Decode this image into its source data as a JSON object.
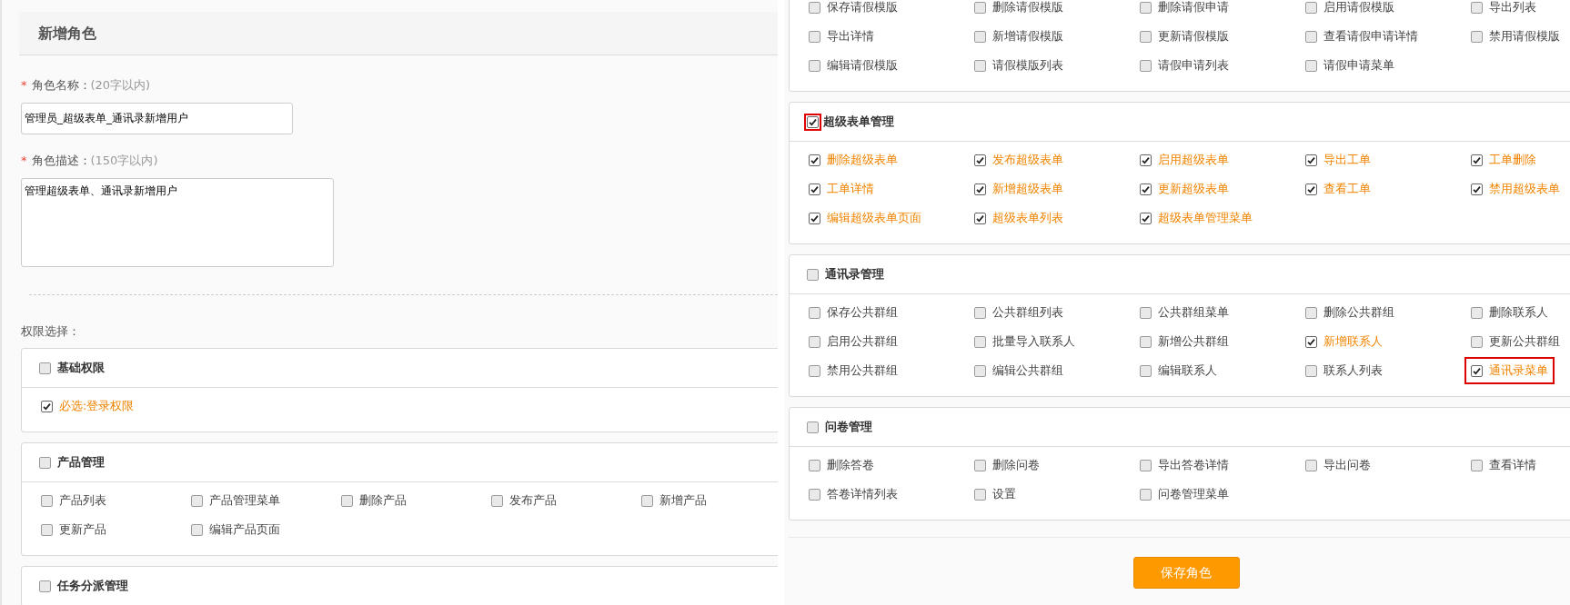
{
  "left": {
    "title": "新增角色",
    "fields": [
      {
        "kind": "input",
        "required_mark": "*",
        "label": "角色名称：",
        "hint": "(20字以内)",
        "value": "管理员_超级表单_通讯录新增用户"
      },
      {
        "kind": "textarea",
        "required_mark": "*",
        "label": "角色描述：",
        "hint": "(150字以内)",
        "value": "管理超级表单、通讯录新增用户"
      }
    ],
    "permissions_label": "权限选择：",
    "groups": [
      {
        "title": "基础权限",
        "checked": false,
        "highlighted": false,
        "items": [
          {
            "label": "必选:登录权限",
            "checked": true,
            "highlighted": false
          }
        ]
      },
      {
        "title": "产品管理",
        "checked": false,
        "highlighted": false,
        "items": [
          {
            "label": "产品列表",
            "checked": false,
            "highlighted": false
          },
          {
            "label": "产品管理菜单",
            "checked": false,
            "highlighted": false
          },
          {
            "label": "删除产品",
            "checked": false,
            "highlighted": false
          },
          {
            "label": "发布产品",
            "checked": false,
            "highlighted": false
          },
          {
            "label": "新增产品",
            "checked": false,
            "highlighted": false
          },
          {
            "label": "更新产品",
            "checked": false,
            "highlighted": false
          },
          {
            "label": "编辑产品页面",
            "checked": false,
            "highlighted": false
          }
        ]
      },
      {
        "title": "任务分派管理",
        "checked": false,
        "highlighted": false
      }
    ]
  },
  "right": {
    "groups": [
      {
        "items": [
          {
            "label": "保存请假模版",
            "checked": false,
            "highlighted": false
          },
          {
            "label": "删除请假模版",
            "checked": false,
            "highlighted": false
          },
          {
            "label": "删除请假申请",
            "checked": false,
            "highlighted": false
          },
          {
            "label": "启用请假模版",
            "checked": false,
            "highlighted": false
          },
          {
            "label": "导出列表",
            "checked": false,
            "highlighted": false
          },
          {
            "label": "导出详情",
            "checked": false,
            "highlighted": false
          },
          {
            "label": "新增请假模版",
            "checked": false,
            "highlighted": false
          },
          {
            "label": "更新请假模版",
            "checked": false,
            "highlighted": false
          },
          {
            "label": "查看请假申请详情",
            "checked": false,
            "highlighted": false
          },
          {
            "label": "禁用请假模版",
            "checked": false,
            "highlighted": false
          },
          {
            "label": "编辑请假模版",
            "checked": false,
            "highlighted": false
          },
          {
            "label": "请假模版列表",
            "checked": false,
            "highlighted": false
          },
          {
            "label": "请假申请列表",
            "checked": false,
            "highlighted": false
          },
          {
            "label": "请假申请菜单",
            "checked": false,
            "highlighted": false
          }
        ]
      },
      {
        "title": "超级表单管理",
        "checked": true,
        "highlighted": true,
        "items": [
          {
            "label": "删除超级表单",
            "checked": true,
            "highlighted": false
          },
          {
            "label": "发布超级表单",
            "checked": true,
            "highlighted": false
          },
          {
            "label": "启用超级表单",
            "checked": true,
            "highlighted": false
          },
          {
            "label": "导出工单",
            "checked": true,
            "highlighted": false
          },
          {
            "label": "工单删除",
            "checked": true,
            "highlighted": false
          },
          {
            "label": "工单详情",
            "checked": true,
            "highlighted": false
          },
          {
            "label": "新增超级表单",
            "checked": true,
            "highlighted": false
          },
          {
            "label": "更新超级表单",
            "checked": true,
            "highlighted": false
          },
          {
            "label": "查看工单",
            "checked": true,
            "highlighted": false
          },
          {
            "label": "禁用超级表单",
            "checked": true,
            "highlighted": false
          },
          {
            "label": "编辑超级表单页面",
            "checked": true,
            "highlighted": false
          },
          {
            "label": "超级表单列表",
            "checked": true,
            "highlighted": false
          },
          {
            "label": "超级表单管理菜单",
            "checked": true,
            "highlighted": false
          }
        ]
      },
      {
        "title": "通讯录管理",
        "checked": false,
        "highlighted": false,
        "items": [
          {
            "label": "保存公共群组",
            "checked": false,
            "highlighted": false
          },
          {
            "label": "公共群组列表",
            "checked": false,
            "highlighted": false
          },
          {
            "label": "公共群组菜单",
            "checked": false,
            "highlighted": false
          },
          {
            "label": "删除公共群组",
            "checked": false,
            "highlighted": false
          },
          {
            "label": "删除联系人",
            "checked": false,
            "highlighted": false
          },
          {
            "label": "启用公共群组",
            "checked": false,
            "highlighted": false
          },
          {
            "label": "批量导入联系人",
            "checked": false,
            "highlighted": false
          },
          {
            "label": "新增公共群组",
            "checked": false,
            "highlighted": false
          },
          {
            "label": "新增联系人",
            "checked": true,
            "highlighted": false
          },
          {
            "label": "更新公共群组",
            "checked": false,
            "highlighted": false
          },
          {
            "label": "禁用公共群组",
            "checked": false,
            "highlighted": false
          },
          {
            "label": "编辑公共群组",
            "checked": false,
            "highlighted": false
          },
          {
            "label": "编辑联系人",
            "checked": false,
            "highlighted": false
          },
          {
            "label": "联系人列表",
            "checked": false,
            "highlighted": false
          },
          {
            "label": "通讯录菜单",
            "checked": true,
            "highlighted": true
          }
        ]
      },
      {
        "title": "问卷管理",
        "checked": false,
        "highlighted": false,
        "items": [
          {
            "label": "删除答卷",
            "checked": false,
            "highlighted": false
          },
          {
            "label": "删除问卷",
            "checked": false,
            "highlighted": false
          },
          {
            "label": "导出答卷详情",
            "checked": false,
            "highlighted": false
          },
          {
            "label": "导出问卷",
            "checked": false,
            "highlighted": false
          },
          {
            "label": "查看详情",
            "checked": false,
            "highlighted": false
          },
          {
            "label": "答卷详情列表",
            "checked": false,
            "highlighted": false
          },
          {
            "label": "设置",
            "checked": false,
            "highlighted": false
          },
          {
            "label": "问卷管理菜单",
            "checked": false,
            "highlighted": false
          }
        ]
      }
    ],
    "save_button": "保存角色"
  }
}
